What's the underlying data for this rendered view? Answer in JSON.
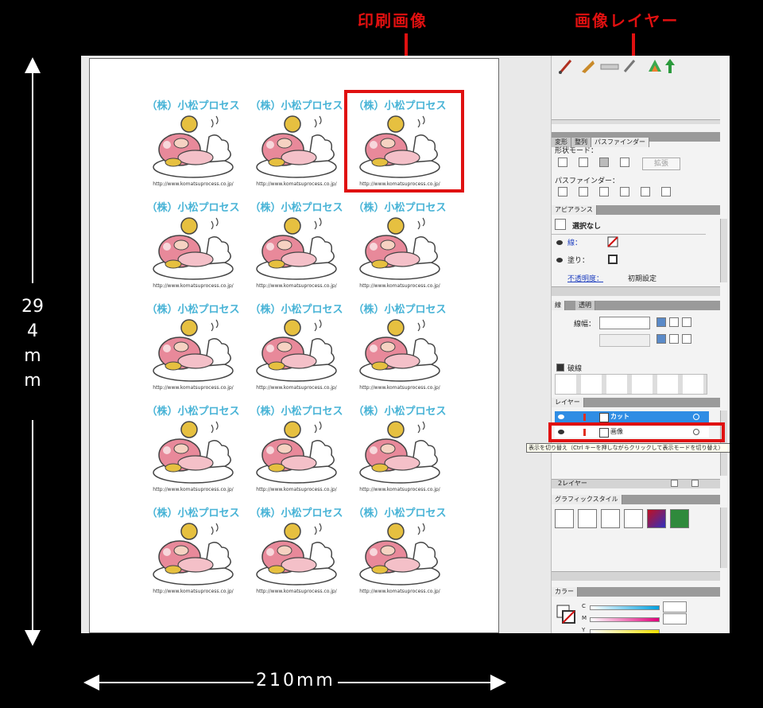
{
  "annotations": {
    "print_image_label": "印刷画像",
    "image_layer_label": "画像レイヤー",
    "accent_color": "#e01010"
  },
  "dimensions": {
    "height_text": "294mm",
    "width_text": "210mm"
  },
  "sticker": {
    "title": "（株）小松プロセス",
    "url": "http://www.komatsuprocess.co.jp/",
    "title_color": "#47b3d6",
    "rows": 5,
    "columns": 3
  },
  "panels": {
    "pathfinder": {
      "tabs": [
        "変形",
        "整列",
        "パスファインダー"
      ],
      "shape_modes_label": "形状モード：",
      "expand_button": "拡張",
      "pathfinders_label": "パスファインダー："
    },
    "appearance": {
      "tab": "アピアランス",
      "object_label": "選択なし",
      "stroke_label": "線：",
      "fill_label": "塗り：",
      "opacity_label": "不透明度：",
      "opacity_value": "初期設定"
    },
    "stroke": {
      "tabs": [
        "線",
        "透明"
      ],
      "weight_label": "線幅：",
      "dashed_label": "破線"
    },
    "layers": {
      "tab": "レイヤー",
      "footer_label": "2レイヤー",
      "items": [
        {
          "name": "カット",
          "selected": true
        },
        {
          "name": "画像",
          "selected": false
        }
      ],
      "tooltip": "表示を切り替え（Ctrl キーを押しながらクリックして表示モードを切り替え）"
    },
    "graphic_styles": {
      "tab": "グラフィックスタイル"
    },
    "color": {
      "tab": "カラー",
      "channels": [
        "C",
        "M",
        "Y"
      ]
    }
  }
}
